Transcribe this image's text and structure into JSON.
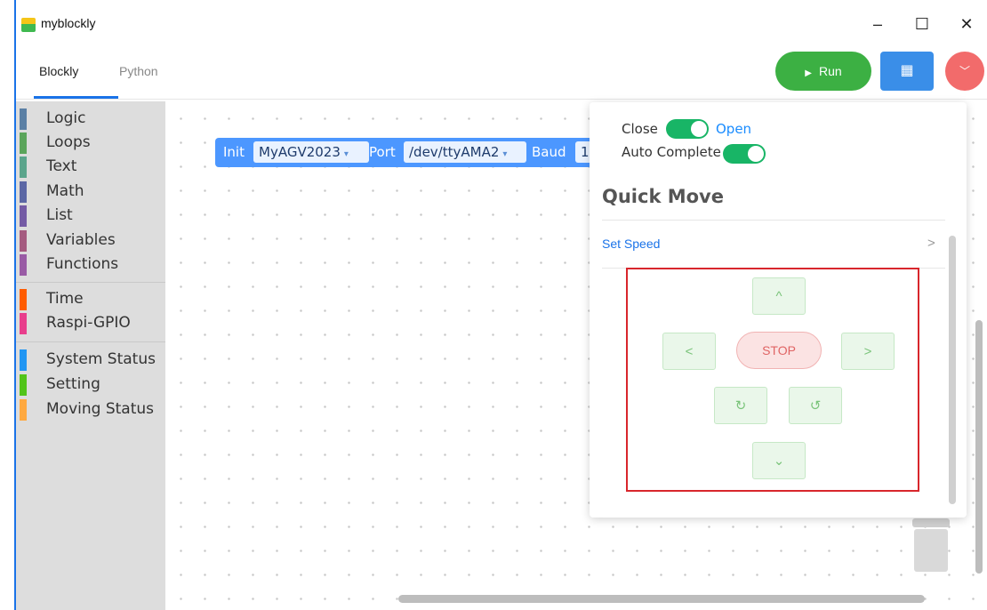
{
  "window": {
    "title": "myblockly",
    "minimize": "–",
    "maximize": "☐",
    "close": "✕"
  },
  "tabs": [
    {
      "label": "Blockly"
    },
    {
      "label": "Python"
    }
  ],
  "toolbar": {
    "run_label": "Run",
    "run_icon": "▶",
    "grid_icon": "▦",
    "menu_icon": "﹀"
  },
  "sidebar": {
    "categories": [
      {
        "label": "Logic",
        "color": "#5b80a5"
      },
      {
        "label": "Loops",
        "color": "#5ba55b"
      },
      {
        "label": "Text",
        "color": "#5ba58c"
      },
      {
        "label": "Math",
        "color": "#5b67a5"
      },
      {
        "label": "List",
        "color": "#745ba5"
      },
      {
        "label": "Variables",
        "color": "#a55b80"
      },
      {
        "label": "Functions",
        "color": "#995ba5"
      },
      {
        "label": "Time",
        "color": "#ff5c00"
      },
      {
        "label": "Raspi-GPIO",
        "color": "#e83e8c"
      },
      {
        "label": "System Status",
        "color": "#2196f3"
      },
      {
        "label": "Setting",
        "color": "#52c41a"
      },
      {
        "label": "Moving Status",
        "color": "#ffa940"
      }
    ]
  },
  "block": {
    "init": "Init",
    "agv": "MyAGV2023",
    "port_label": "Port",
    "port": "/dev/ttyAMA2",
    "baud_label": "Baud",
    "baud_partial": "1"
  },
  "panel": {
    "close_label": "Close",
    "open_label": "Open",
    "auto_complete": "Auto Complete",
    "title": "Quick Move",
    "set_speed": "Set Speed",
    "chevron": ">",
    "up": "^",
    "left": "<",
    "stop": "STOP",
    "right": ">",
    "rotate_cw": "↻",
    "rotate_ccw": "↺",
    "down": "⌄"
  }
}
